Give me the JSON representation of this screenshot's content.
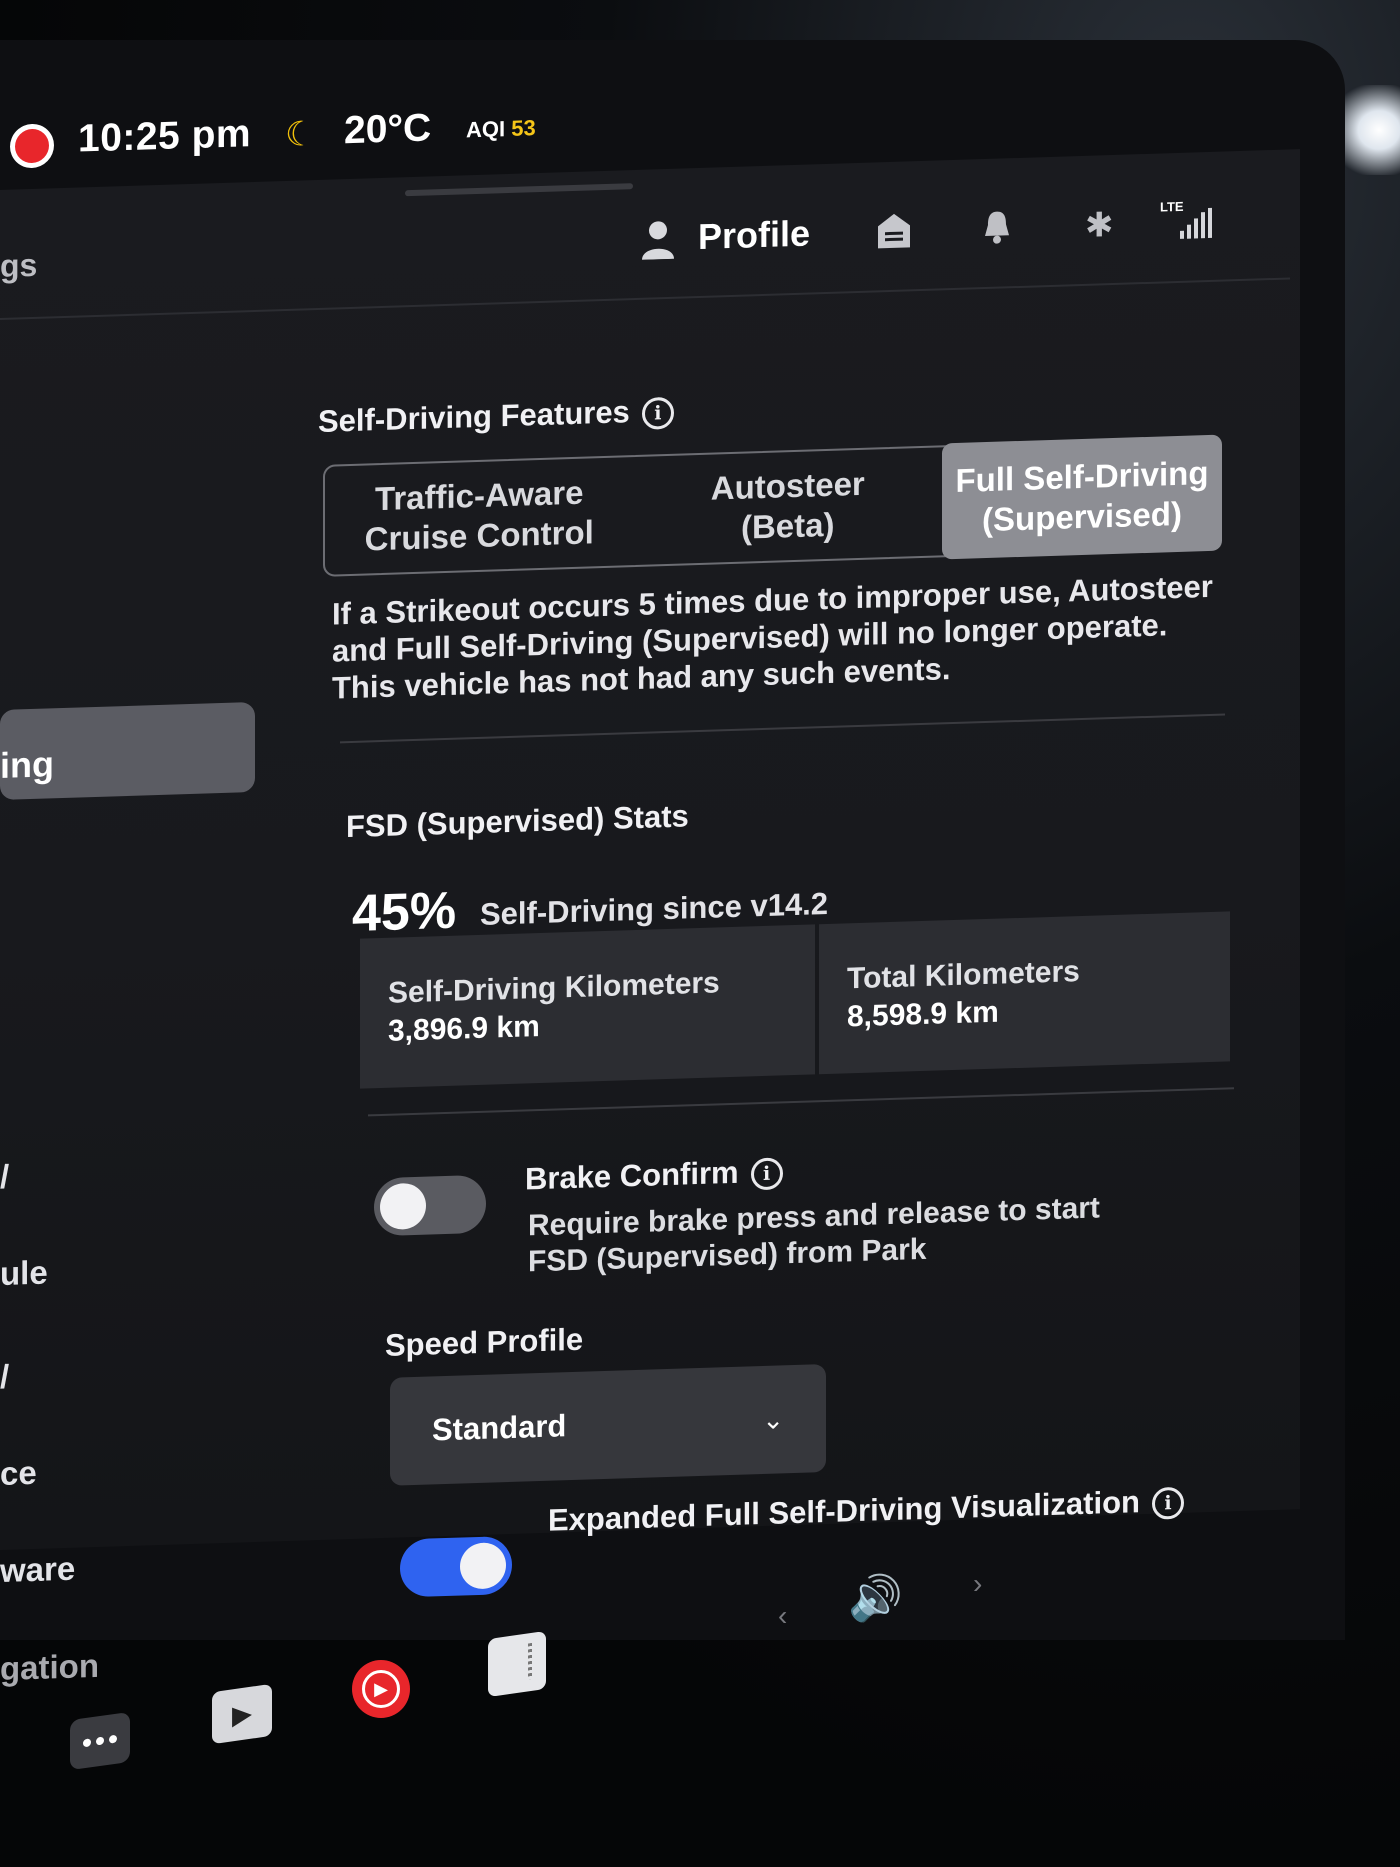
{
  "status_bar": {
    "time": "10:25 pm",
    "temperature": "20°C",
    "aqi_label": "AQI",
    "aqi_value": "53"
  },
  "top_nav": {
    "breadcrumb_partial": "gs",
    "profile_label": "Profile",
    "lte_label": "LTE",
    "icons": [
      "profile-icon",
      "home-icon",
      "bell-icon",
      "bluetooth-icon",
      "signal-icon"
    ]
  },
  "sidebar": {
    "active_partial": "ing",
    "items_partial": [
      "/",
      "ule",
      "/",
      "ce",
      "ware",
      "gation"
    ]
  },
  "self_driving": {
    "title": "Self-Driving Features",
    "options": [
      {
        "line1": "Traffic-Aware",
        "line2": "Cruise Control"
      },
      {
        "line1": "Autosteer",
        "line2": "(Beta)"
      },
      {
        "line1": "Full Self-Driving",
        "line2": "(Supervised)"
      }
    ],
    "selected": "Full Self-Driving (Supervised)",
    "warning": "If a Strikeout occurs 5 times due to improper use, Autosteer and Full Self-Driving (Supervised) will no longer operate. This vehicle has not had any such events."
  },
  "stats": {
    "title": "FSD (Supervised) Stats",
    "percent": "45%",
    "percent_label": "Self-Driving since v14.2",
    "self_driving_km_label": "Self-Driving Kilometers",
    "self_driving_km_value": "3,896.9 km",
    "total_km_label": "Total Kilometers",
    "total_km_value": "8,598.9 km"
  },
  "brake_confirm": {
    "title": "Brake Confirm",
    "description": "Require brake press and release to start FSD (Supervised) from Park",
    "enabled": false
  },
  "speed_profile": {
    "label": "Speed Profile",
    "value": "Standard"
  },
  "visualization": {
    "title": "Expanded Full Self-Driving Visualization",
    "enabled": true
  },
  "colors": {
    "toggle_on": "#2f63f0",
    "record": "#e8262b",
    "moon": "#f2c10a",
    "aqi_value": "#f5c518"
  }
}
